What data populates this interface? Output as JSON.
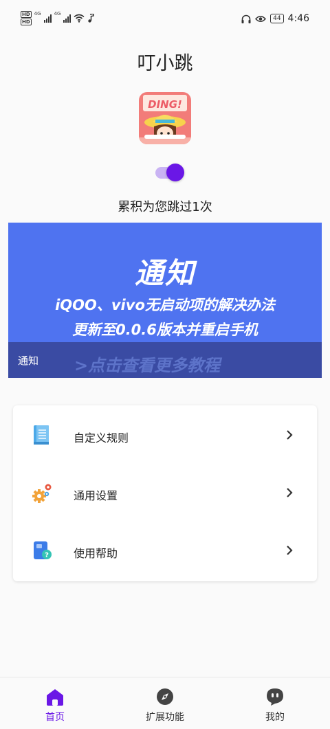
{
  "status_bar": {
    "hd1": "HD",
    "hd2": "HD",
    "net1": "4G",
    "net2": "4G",
    "battery": "44",
    "time": "4:46"
  },
  "header": {
    "title": "叮小跳"
  },
  "app_icon": {
    "name": "app-logo",
    "text": "DING!"
  },
  "toggle": {
    "state": "on"
  },
  "stats": {
    "count_text": "累积为您跳过1次"
  },
  "banner": {
    "title": "通知",
    "line1": "iQOO、vivo无启动项的解决办法",
    "line2": "更新至0.0.6版本并重启手机",
    "caption": "通知",
    "more": ">点击查看更多教程"
  },
  "menu": {
    "items": [
      {
        "label": "自定义规则",
        "icon": "document-list-icon"
      },
      {
        "label": "通用设置",
        "icon": "gears-icon"
      },
      {
        "label": "使用帮助",
        "icon": "help-book-icon"
      }
    ]
  },
  "bottom_nav": {
    "items": [
      {
        "label": "首页",
        "icon": "home-icon",
        "active": true
      },
      {
        "label": "扩展功能",
        "icon": "compass-icon",
        "active": false
      },
      {
        "label": "我的",
        "icon": "profile-icon",
        "active": false
      }
    ]
  },
  "colors": {
    "accent": "#6a17e6",
    "banner": "#4f73f0",
    "banner_bar": "#3a4ba3"
  }
}
